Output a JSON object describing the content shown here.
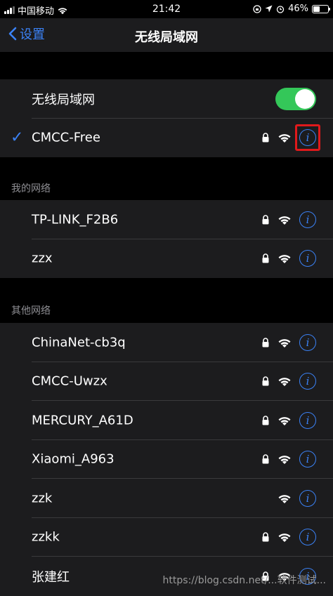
{
  "status_bar": {
    "carrier": "中国移动",
    "time": "21:42",
    "battery_percent": "46%",
    "battery_level": 0.46,
    "icons": [
      "signal-icon",
      "wifi-icon",
      "rotation-lock-icon",
      "location-icon",
      "alarm-icon",
      "battery-icon"
    ]
  },
  "nav": {
    "back_label": "设置",
    "title": "无线局域网"
  },
  "wifi_toggle": {
    "label": "无线局域网",
    "on": true,
    "color": "#34c759"
  },
  "connected": {
    "name": "CMCC-Free",
    "locked": true
  },
  "my_networks": {
    "header": "我的网络",
    "items": [
      {
        "name": "TP-LINK_F2B6",
        "locked": true
      },
      {
        "name": "zzx",
        "locked": true
      }
    ]
  },
  "other_networks": {
    "header": "其他网络",
    "items": [
      {
        "name": "ChinaNet-cb3q",
        "locked": true
      },
      {
        "name": "CMCC-Uwzx",
        "locked": true
      },
      {
        "name": "MERCURY_A61D",
        "locked": true
      },
      {
        "name": "Xiaomi_A963",
        "locked": true
      },
      {
        "name": "zzk",
        "locked": false
      },
      {
        "name": "zzkk",
        "locked": true
      },
      {
        "name": "张建红",
        "locked": true
      }
    ]
  },
  "watermark": "https://blog.csdn.net/...软件测试..."
}
